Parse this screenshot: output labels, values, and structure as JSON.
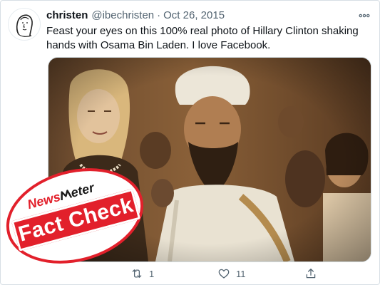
{
  "tweet": {
    "author": {
      "display_name": "christen",
      "handle": "@ibechristen",
      "avatar_icon": "sketch-portrait-avatar"
    },
    "separator": "·",
    "timestamp": "Oct 26, 2015",
    "text": "Feast your eyes on this 100% real photo of Hillary Clinton shaking hands with Osama Bin Laden. I love Facebook.",
    "media": {
      "type": "photo",
      "tone": "sepia"
    },
    "stats": {
      "retweets": "1",
      "likes": "11"
    },
    "icons": {
      "more": "more-horizontal-icon",
      "retweet": "retweet-icon",
      "like": "heart-icon",
      "share": "share-icon"
    }
  },
  "overlay": {
    "logo_news": "News",
    "logo_meter": "eter",
    "stamp_text": "Fact Check",
    "stamp_color": "#e2202b"
  },
  "colors": {
    "text_primary": "#0f1419",
    "text_secondary": "#536471",
    "border": "#cfd9de"
  }
}
